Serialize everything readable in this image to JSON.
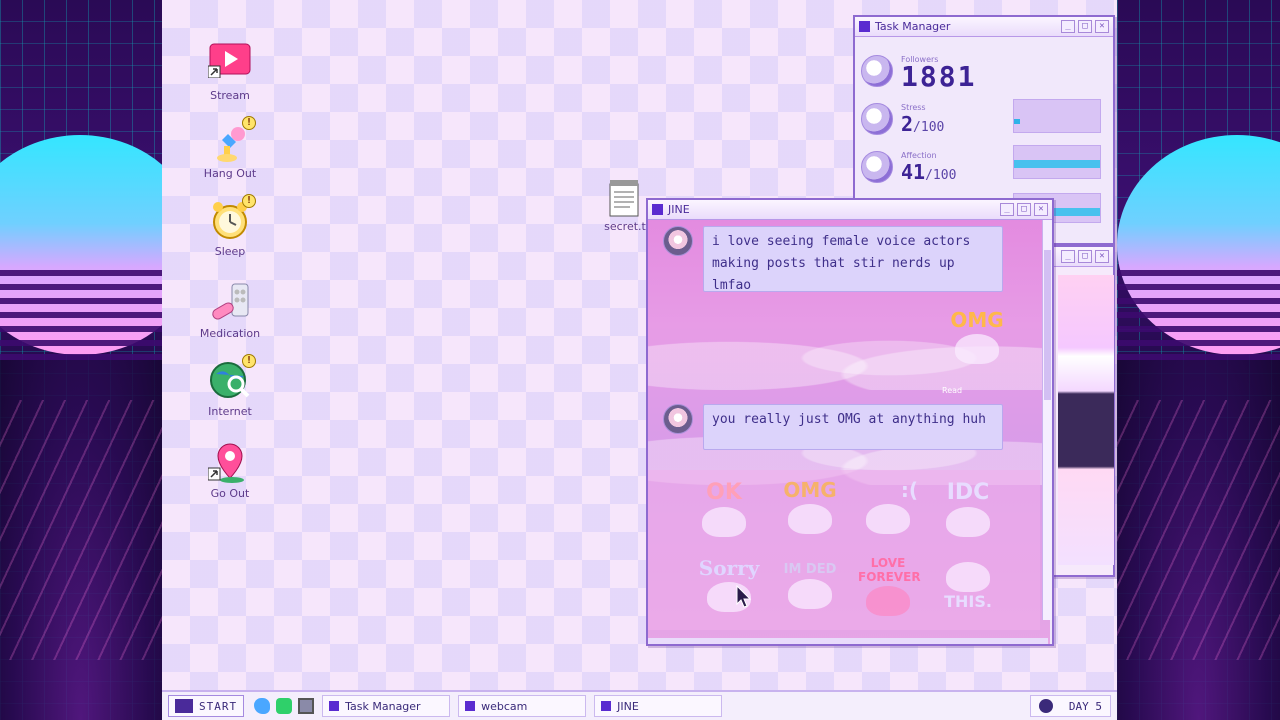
{
  "desktop_icons": [
    {
      "label": "Stream",
      "icon": "stream-icon"
    },
    {
      "label": "Hang Out",
      "icon": "hang-out-icon"
    },
    {
      "label": "Sleep",
      "icon": "sleep-icon"
    },
    {
      "label": "Medication",
      "icon": "medication-icon"
    },
    {
      "label": "Internet",
      "icon": "internet-icon"
    },
    {
      "label": "Go Out",
      "icon": "go-out-icon"
    }
  ],
  "badge_symbol": "!",
  "secret_file": {
    "label": "secret.t"
  },
  "task_manager": {
    "title": "Task Manager",
    "followers_label": "Followers",
    "followers_value": "1881",
    "stress_label": "Stress",
    "stress_value": "2",
    "stress_max": "/100",
    "affection_label": "Affection",
    "affection_value": "41",
    "affection_max": "/100",
    "stress_level": 0.02,
    "affection_level": 0.41
  },
  "chat": {
    "title": "JINE",
    "messages": [
      {
        "text": "i love seeing female voice actors making posts that stir nerds up lmfao"
      },
      {
        "text": "you really just OMG at anything huh"
      }
    ],
    "sent_sticker": "OMG",
    "read_label": "Read",
    "stickers": [
      "OK",
      "OMG",
      ":(",
      "IDC",
      "Sorry",
      "IM DED",
      "LOVE FOREVER",
      "THIS."
    ]
  },
  "taskbar": {
    "start_label": "START",
    "items": [
      "Task Manager",
      "webcam",
      "JINE"
    ],
    "day_label": "DAY 5"
  },
  "colors": {
    "accent": "#5a2bd0",
    "meter_fill": "#2fb3e8",
    "chat_bg": "#e38be0"
  }
}
